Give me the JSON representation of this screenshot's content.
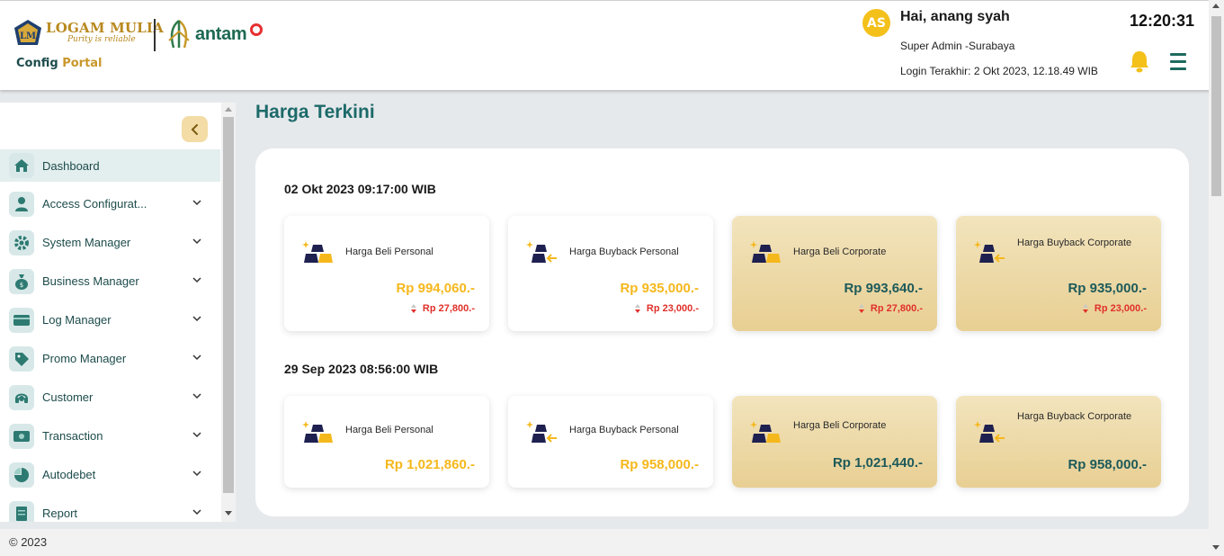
{
  "header": {
    "brand_name": "LOGAM MULIA",
    "brand_tagline": "Purity is reliable",
    "partner_name": "antam",
    "portal_prefix": "Config",
    "portal_suffix": "Portal",
    "user": {
      "initials": "AS",
      "greeting": "Hai, anang syah",
      "role": "Super Admin -Surabaya",
      "last_login": "Login Terakhir: 2 Okt 2023, 12.18.49 WIB"
    },
    "clock": "12:20:31",
    "icons": {
      "notification": "bell-icon",
      "menu": "hamburger-icon"
    }
  },
  "sidebar": {
    "collapse_icon": "chevron-left-icon",
    "items": [
      {
        "label": "Dashboard",
        "icon": "home-icon",
        "active": true,
        "expandable": false
      },
      {
        "label": "Access Configurat...",
        "icon": "user-icon",
        "active": false,
        "expandable": true
      },
      {
        "label": "System Manager",
        "icon": "gear-icon",
        "active": false,
        "expandable": true
      },
      {
        "label": "Business Manager",
        "icon": "money-bag-icon",
        "active": false,
        "expandable": true
      },
      {
        "label": "Log Manager",
        "icon": "card-icon",
        "active": false,
        "expandable": true
      },
      {
        "label": "Promo Manager",
        "icon": "tag-icon",
        "active": false,
        "expandable": true
      },
      {
        "label": "Customer",
        "icon": "headset-icon",
        "active": false,
        "expandable": true
      },
      {
        "label": "Transaction",
        "icon": "cash-icon",
        "active": false,
        "expandable": true
      },
      {
        "label": "Autodebet",
        "icon": "pie-icon",
        "active": false,
        "expandable": true
      },
      {
        "label": "Report",
        "icon": "report-icon",
        "active": false,
        "expandable": true
      }
    ]
  },
  "main": {
    "title": "Harga Terkini",
    "groups": [
      {
        "date": "02 Okt 2023 09:17:00 WIB",
        "cards": [
          {
            "title": "Harga Beli Personal",
            "price": "Rp 994,060.-",
            "diff": "Rp 27,800.-",
            "style": "white",
            "icon": "gold-bars-icon"
          },
          {
            "title": "Harga Buyback Personal",
            "price": "Rp 935,000.-",
            "diff": "Rp 23,000.-",
            "style": "white",
            "icon": "gold-buyback-icon"
          },
          {
            "title": "Harga Beli Corporate",
            "price": "Rp 993,640.-",
            "diff": "Rp 27,800.-",
            "style": "gold",
            "icon": "gold-bars-icon"
          },
          {
            "title": "Harga Buyback Corporate",
            "price": "Rp 935,000.-",
            "diff": "Rp 23,000.-",
            "style": "gold",
            "icon": "gold-buyback-icon"
          }
        ]
      },
      {
        "date": "29 Sep 2023 08:56:00 WIB",
        "cards": [
          {
            "title": "Harga Beli Personal",
            "price": "Rp 1,021,860.-",
            "style": "white",
            "icon": "gold-bars-icon"
          },
          {
            "title": "Harga Buyback Personal",
            "price": "Rp 958,000.-",
            "style": "white",
            "icon": "gold-buyback-icon"
          },
          {
            "title": "Harga Beli Corporate",
            "price": "Rp 1,021,440.-",
            "style": "gold",
            "icon": "gold-bars-icon"
          },
          {
            "title": "Harga Buyback Corporate",
            "price": "Rp 958,000.-",
            "style": "gold",
            "icon": "gold-buyback-icon"
          }
        ]
      }
    ]
  },
  "footer": {
    "copyright": "© 2023"
  },
  "colors": {
    "teal": "#1d6a6a",
    "gold": "#f5b81c",
    "gold_card": "#e8cf93",
    "down_red": "#e0302a"
  }
}
